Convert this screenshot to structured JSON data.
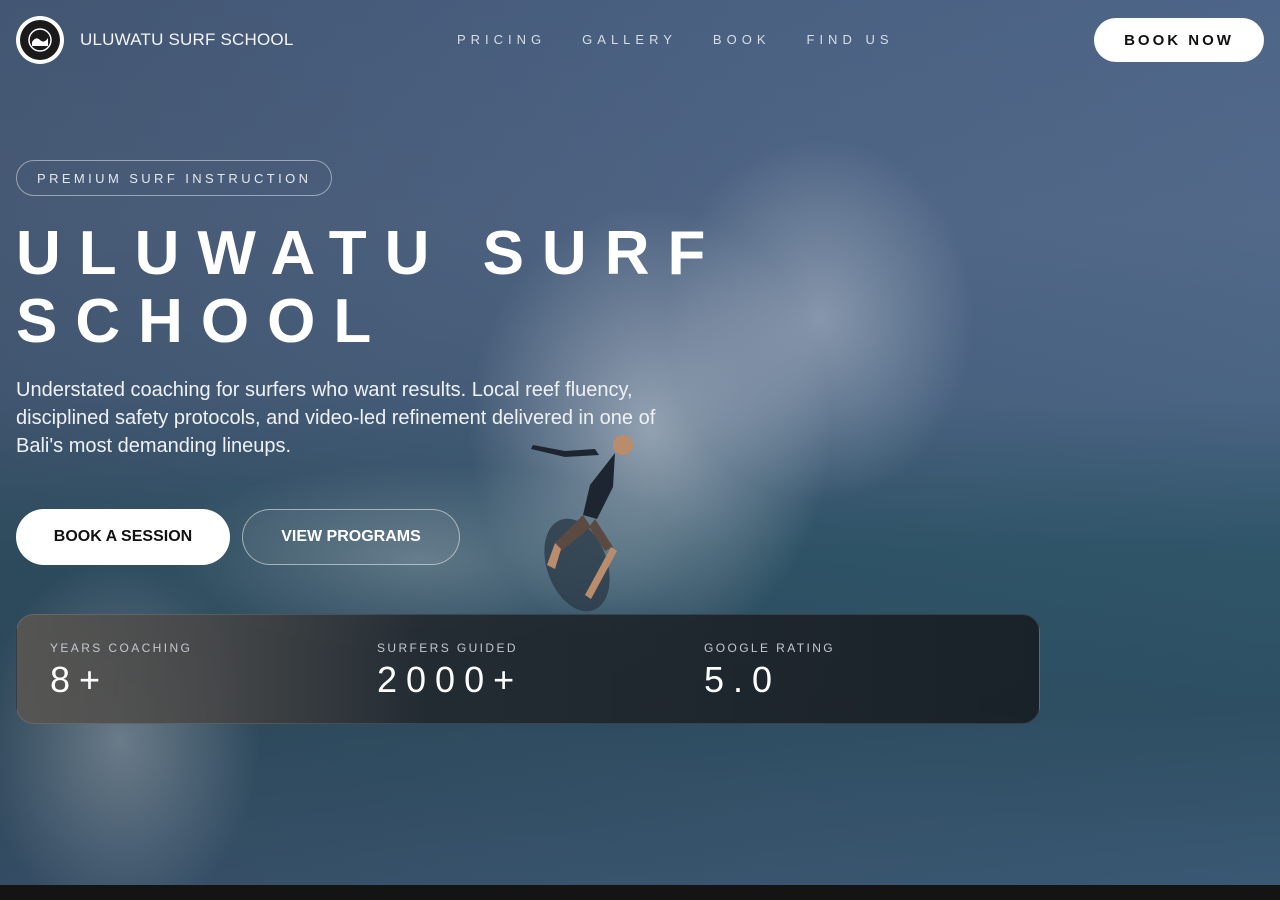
{
  "nav": {
    "brand": "ULUWATU SURF SCHOOL",
    "links": [
      "PRICING",
      "GALLERY",
      "BOOK",
      "FIND US"
    ],
    "cta": "BOOK NOW"
  },
  "hero": {
    "tag": "PREMIUM SURF INSTRUCTION",
    "title": "ULUWATU SURF SCHOOL",
    "subtitle": "Understated coaching for surfers who want results. Local reef fluency, disciplined safety protocols, and video-led refinement delivered in one of Bali's most demanding lineups.",
    "primary_button": "BOOK A SESSION",
    "secondary_button": "VIEW PROGRAMS"
  },
  "stats": [
    {
      "label": "YEARS COACHING",
      "value": "8+"
    },
    {
      "label": "SURFERS GUIDED",
      "value": "2000+"
    },
    {
      "label": "GOOGLE RATING",
      "value": "5.0"
    }
  ],
  "colors": {
    "accent": "#ffffff",
    "ocean": "#4a6483",
    "panel": "#1c2228"
  }
}
